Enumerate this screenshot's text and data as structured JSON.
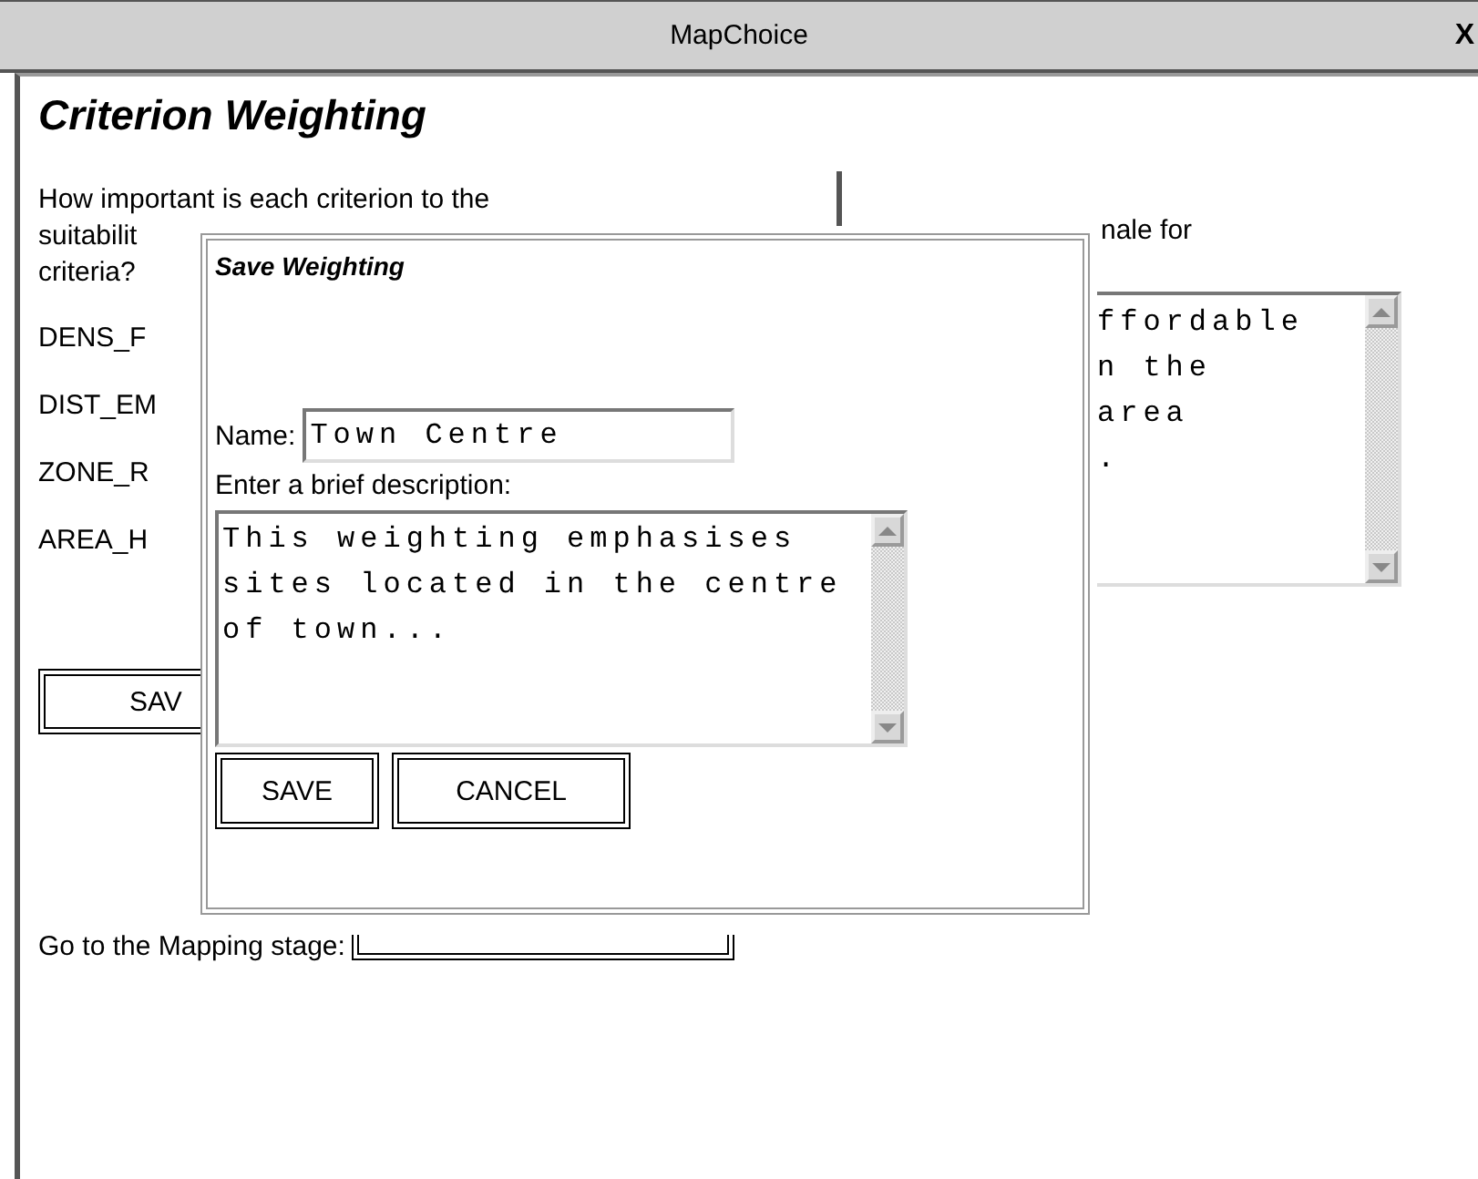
{
  "window": {
    "title": "MapChoice",
    "close": "X"
  },
  "heading": "Criterion Weighting",
  "question_lines": [
    "How important is each criterion to the",
    "suitabilit",
    "criteria?"
  ],
  "criteria": [
    "DENS_F",
    "DIST_EM",
    "ZONE_R",
    "AREA_H"
  ],
  "save_button": "SAV",
  "mapping_prompt": "Go to the Mapping stage:",
  "rationale_label": "nale for",
  "rationale_lines": [
    "ffordable",
    "n the",
    "area",
    "."
  ],
  "dialog": {
    "title": "Save Weighting",
    "name_label": "Name:",
    "name_value": "Town Centre",
    "description_label": "Enter a brief description:",
    "description_lines": [
      "This weighting emphasises",
      "sites located in the centre",
      "of town..."
    ],
    "buttons": [
      "SAVE",
      "CANCEL"
    ]
  }
}
